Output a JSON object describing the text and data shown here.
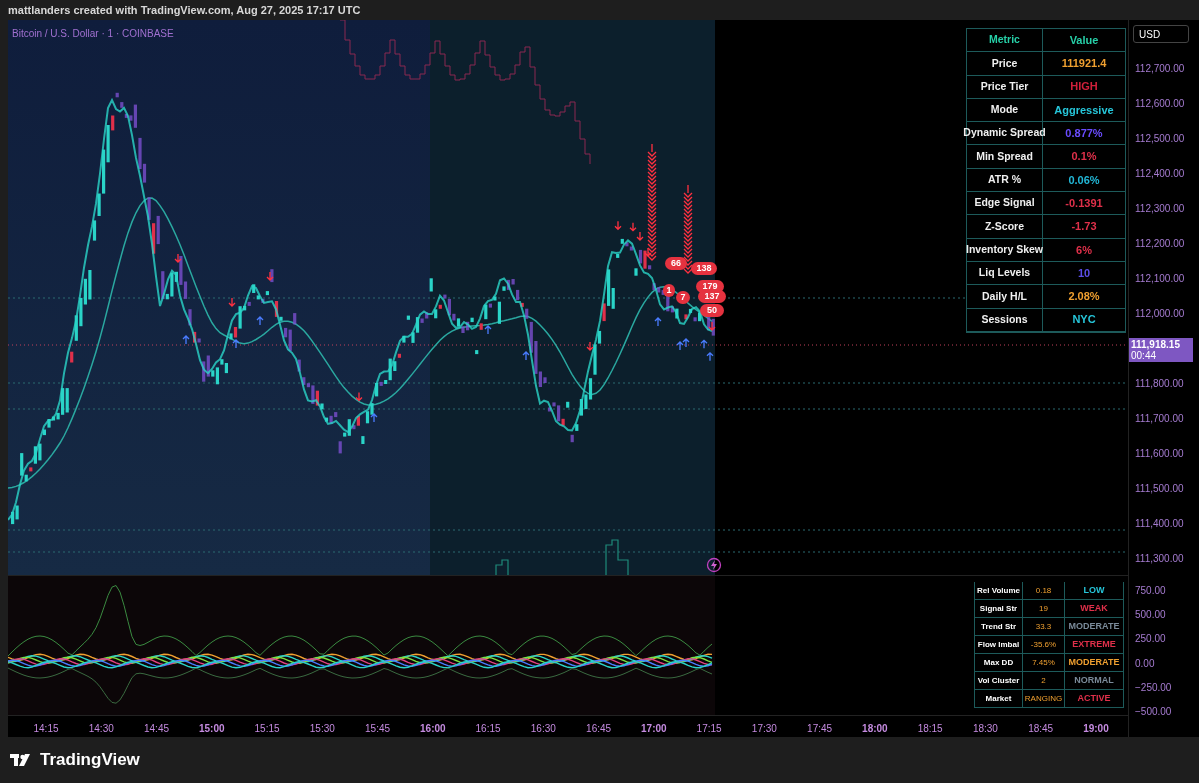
{
  "header": {
    "attribution": "mattlanders created with TradingView.com, Aug 27, 2025 17:17 UTC"
  },
  "chart": {
    "symbol_title": "Bitcoin / U.S. Dollar · 1 · COINBASE",
    "currency_button": "USD",
    "price_axis": [
      "112,700.00",
      "112,600.00",
      "112,500.00",
      "112,400.00",
      "112,300.00",
      "112,200.00",
      "112,100.00",
      "112,000.00",
      "111,800.00",
      "111,700.00",
      "111,600.00",
      "111,500.00",
      "111,400.00",
      "111,300.00"
    ],
    "last_price": {
      "price": "111,918.15",
      "countdown": "00:44"
    },
    "bubbles": [
      "66",
      "138",
      "1",
      "7",
      "179",
      "137",
      "50"
    ],
    "metrics_table": {
      "columns": [
        "Metric",
        "Value"
      ],
      "rows": [
        {
          "metric": "Price",
          "value": "111921.4",
          "color": "#f0a030"
        },
        {
          "metric": "Price Tier",
          "value": "HIGH",
          "color": "#d0203a"
        },
        {
          "metric": "Mode",
          "value": "Aggressive",
          "color": "#26c6da"
        },
        {
          "metric": "Dynamic Spread",
          "value": "0.877%",
          "color": "#6a4cff"
        },
        {
          "metric": "Min Spread",
          "value": "0.1%",
          "color": "#e0304a"
        },
        {
          "metric": "ATR %",
          "value": "0.06%",
          "color": "#22b8d8"
        },
        {
          "metric": "Edge Signal",
          "value": "-0.1391",
          "color": "#e0304a"
        },
        {
          "metric": "Z-Score",
          "value": "-1.73",
          "color": "#e0304a"
        },
        {
          "metric": "Inventory Skew",
          "value": "6%",
          "color": "#e0304a"
        },
        {
          "metric": "Liq Levels",
          "value": "10",
          "color": "#5b4ee8"
        },
        {
          "metric": "Daily H/L",
          "value": "2.08%",
          "color": "#f0a030"
        },
        {
          "metric": "Sessions",
          "value": "NYC",
          "color": "#26c6da"
        }
      ]
    },
    "oscillator_axis": [
      "750.00",
      "500.00",
      "250.00",
      "0.00",
      "−250.00",
      "−500.00"
    ],
    "stats_table": {
      "rows": [
        {
          "label": "Rel Volume",
          "value": "0.18",
          "status": "LOW",
          "color": "#26c6da"
        },
        {
          "label": "Signal Str",
          "value": "19",
          "status": "WEAK",
          "color": "#e0304a"
        },
        {
          "label": "Trend Str",
          "value": "33.3",
          "status": "MODERATE",
          "color": "#7a8a99"
        },
        {
          "label": "Flow Imbal",
          "value": "-35.6%",
          "status": "EXTREME",
          "color": "#e0304a"
        },
        {
          "label": "Max DD",
          "value": "7.45%",
          "status": "MODERATE",
          "color": "#f0a030"
        },
        {
          "label": "Vol Cluster",
          "value": "2",
          "status": "NORMAL",
          "color": "#7a8a99"
        },
        {
          "label": "Market",
          "value": "RANGING",
          "status": "ACTIVE",
          "color": "#e0304a"
        }
      ]
    }
  },
  "time_axis": [
    {
      "label": "14:15",
      "major": false
    },
    {
      "label": "14:30",
      "major": false
    },
    {
      "label": "14:45",
      "major": false
    },
    {
      "label": "15:00",
      "major": true
    },
    {
      "label": "15:15",
      "major": false
    },
    {
      "label": "15:30",
      "major": false
    },
    {
      "label": "15:45",
      "major": false
    },
    {
      "label": "16:00",
      "major": true
    },
    {
      "label": "16:15",
      "major": false
    },
    {
      "label": "16:30",
      "major": false
    },
    {
      "label": "16:45",
      "major": false
    },
    {
      "label": "17:00",
      "major": true
    },
    {
      "label": "17:15",
      "major": false
    },
    {
      "label": "17:30",
      "major": false
    },
    {
      "label": "17:45",
      "major": false
    },
    {
      "label": "18:00",
      "major": true
    },
    {
      "label": "18:15",
      "major": false
    },
    {
      "label": "18:30",
      "major": false
    },
    {
      "label": "18:45",
      "major": false
    },
    {
      "label": "19:00",
      "major": true
    }
  ],
  "footer": {
    "brand": "TradingView"
  }
}
